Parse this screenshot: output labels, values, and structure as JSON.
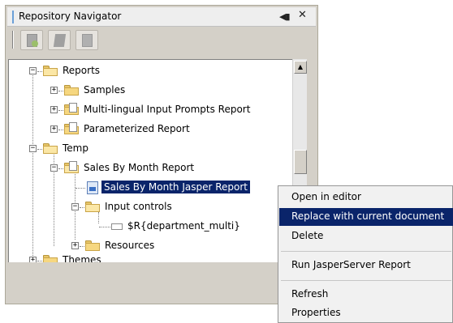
{
  "panel": {
    "title": "Repository Navigator",
    "dock_glyph": "◀▮",
    "close_glyph": "✕",
    "toolbar": {
      "buttons": [
        {
          "name": "add-repository-icon"
        },
        {
          "name": "stack-icon"
        },
        {
          "name": "page-icon"
        }
      ]
    }
  },
  "tree": {
    "items": [
      {
        "label": "Reports",
        "expander": "−"
      },
      {
        "label": "Samples",
        "expander": "+"
      },
      {
        "label": "Multi-lingual Input Prompts Report",
        "expander": "+"
      },
      {
        "label": "Parameterized Report",
        "expander": "+"
      },
      {
        "label": "Temp",
        "expander": "−"
      },
      {
        "label": "Sales By Month Report",
        "expander": "−"
      },
      {
        "label": "Sales By Month Jasper Report",
        "selected": true
      },
      {
        "label": "Input controls",
        "expander": "−"
      },
      {
        "label": "$R{department_multi}"
      },
      {
        "label": "Resources",
        "expander": "+"
      },
      {
        "label": "Themes",
        "expander": "+"
      }
    ],
    "scroll_up_glyph": "▲"
  },
  "context_menu": {
    "items": [
      {
        "label": "Open in editor"
      },
      {
        "label": "Replace with current document",
        "highlighted": true
      },
      {
        "label": "Delete"
      },
      {
        "label": "Run JasperServer Report"
      },
      {
        "label": "Refresh"
      },
      {
        "label": "Properties"
      }
    ]
  },
  "colors": {
    "selection": "#0a246a",
    "panel_bg": "#d4d0c8",
    "folder": "#f6d780"
  }
}
